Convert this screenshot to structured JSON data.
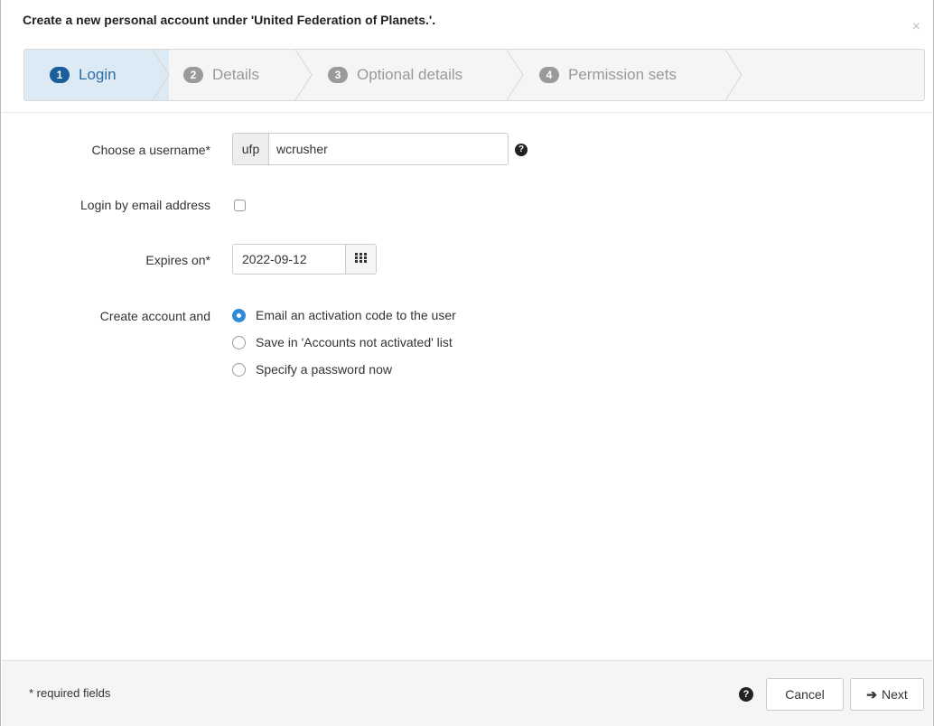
{
  "dialog": {
    "title": "Create a new personal account under 'United Federation of Planets.'.",
    "close_label": "×"
  },
  "wizard": {
    "steps": [
      {
        "number": "1",
        "label": "Login",
        "active": true
      },
      {
        "number": "2",
        "label": "Details",
        "active": false
      },
      {
        "number": "3",
        "label": "Optional details",
        "active": false
      },
      {
        "number": "4",
        "label": "Permission sets",
        "active": false
      }
    ]
  },
  "form": {
    "username": {
      "label": "Choose a username*",
      "prefix": "ufp",
      "value": "wcrusher",
      "help_icon": "question-circle-icon"
    },
    "login_by_email": {
      "label": "Login by email address",
      "checked": false
    },
    "expires_on": {
      "label": "Expires on*",
      "value": "2022-09-12",
      "icon": "calendar-grid-icon"
    },
    "create_account": {
      "label": "Create account and",
      "options": [
        {
          "label": "Email an activation code to the user",
          "selected": true
        },
        {
          "label": "Save in 'Accounts not activated' list",
          "selected": false
        },
        {
          "label": "Specify a password now",
          "selected": false
        }
      ]
    }
  },
  "footer": {
    "required_note": "* required fields",
    "help_icon": "question-circle-icon",
    "cancel_label": "Cancel",
    "next_label": "Next",
    "next_icon": "arrow-right-icon"
  },
  "colors": {
    "active_step_bg": "#dbeaf4",
    "active_step_text": "#2e6da4",
    "radio_selected": "#2f8ad8"
  }
}
